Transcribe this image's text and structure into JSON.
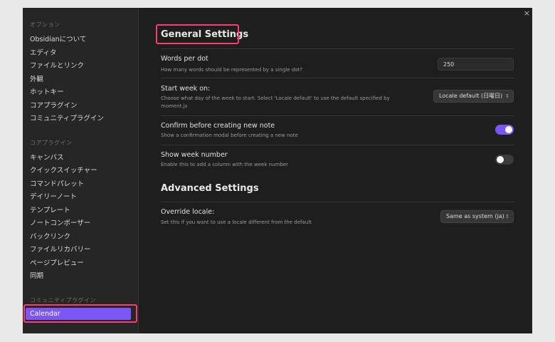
{
  "close_label": "×",
  "sidebar": {
    "sections": [
      {
        "title": "オプション",
        "items": [
          "Obsidianについて",
          "エディタ",
          "ファイルとリンク",
          "外観",
          "ホットキー",
          "コアプラグイン",
          "コミュニティプラグイン"
        ]
      },
      {
        "title": "コアプラグイン",
        "items": [
          "キャンバス",
          "クイックスイッチャー",
          "コマンドパレット",
          "デイリーノート",
          "テンプレート",
          "ノートコンポーザー",
          "バックリンク",
          "ファイルリカバリー",
          "ページプレビュー",
          "同期"
        ]
      },
      {
        "title": "コミュニティプラグイン",
        "items": [
          "Calendar"
        ]
      }
    ],
    "active_item": "Calendar"
  },
  "main": {
    "general_title": "General Settings",
    "settings": [
      {
        "name": "Words per dot",
        "desc": "How many words should be represented by a single dot?",
        "control": "input",
        "value": "250"
      },
      {
        "name": "Start week on:",
        "desc": "Choose what day of the week to start. Select 'Locale default' to use the default specified by moment.js",
        "control": "select",
        "value": "Locale default (日曜日)"
      },
      {
        "name": "Confirm before creating new note",
        "desc": "Show a confirmation modal before creating a new note",
        "control": "toggle",
        "on": true
      },
      {
        "name": "Show week number",
        "desc": "Enable this to add a column with the week number",
        "control": "toggle",
        "on": false
      }
    ],
    "advanced_title": "Advanced Settings",
    "advanced": [
      {
        "name": "Override locale:",
        "desc": "Set this if you want to use a locale different from the default",
        "control": "select",
        "value": "Same as system (ja)"
      }
    ]
  },
  "colors": {
    "accent": "#7b55f5",
    "highlight": "#ff3b70"
  },
  "icons": {
    "close": "close-icon",
    "select": "chevron-updown-icon"
  }
}
